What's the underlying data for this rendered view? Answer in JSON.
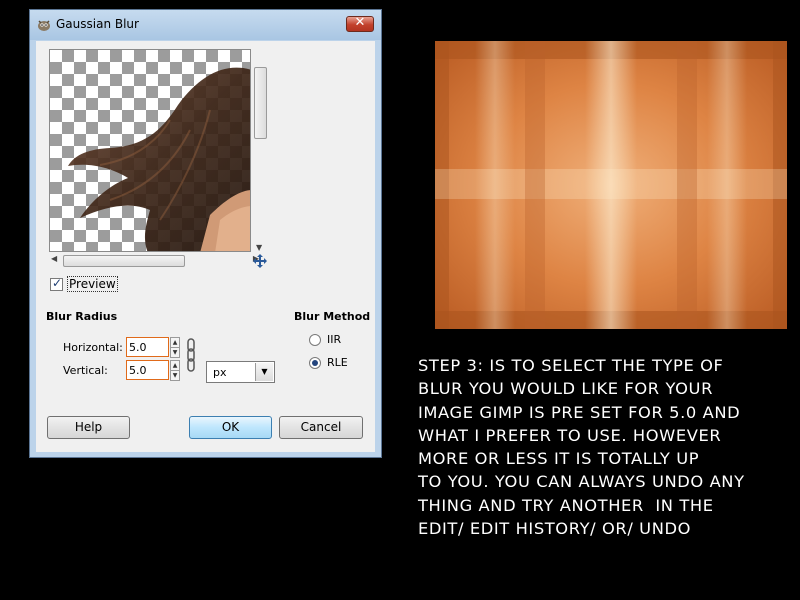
{
  "window": {
    "title": "Gaussian Blur",
    "close_glyph": "✕"
  },
  "preview": {
    "checkbox_label": "Preview",
    "checked": true
  },
  "blur_radius": {
    "heading": "Blur Radius",
    "horizontal_label": "Horizontal:",
    "horizontal_value": "5.0",
    "vertical_label": "Vertical:",
    "vertical_value": "5.0",
    "unit": "px"
  },
  "blur_method": {
    "heading": "Blur Method",
    "options": [
      {
        "label": "IIR",
        "selected": false
      },
      {
        "label": "RLE",
        "selected": true
      }
    ]
  },
  "buttons": {
    "help": "Help",
    "ok": "OK",
    "cancel": "Cancel"
  },
  "icons": {
    "app": "gimp-icon",
    "close": "close-icon",
    "navigate": "navigate-icon",
    "chain": "chain-link-icon",
    "dropdown": "chevron-down-icon"
  },
  "instructions": "STEP 3: IS TO SELECT THE TYPE OF\nBLUR YOU WOULD LIKE FOR YOUR\nIMAGE GIMP IS PRE SET FOR 5.0 AND\nWHAT I PREFER TO USE. HOWEVER\nMORE OR LESS IT IS TOTALLY UP\nTO YOU. YOU CAN ALWAYS UNDO ANY\nTHING AND TRY ANOTHER  IN THE\nEDIT/ EDIT HISTORY/ OR/ UNDO",
  "colors": {
    "background": "#000000",
    "texture_base": "#d97a3c",
    "window_frame": "#bcd3ea"
  }
}
